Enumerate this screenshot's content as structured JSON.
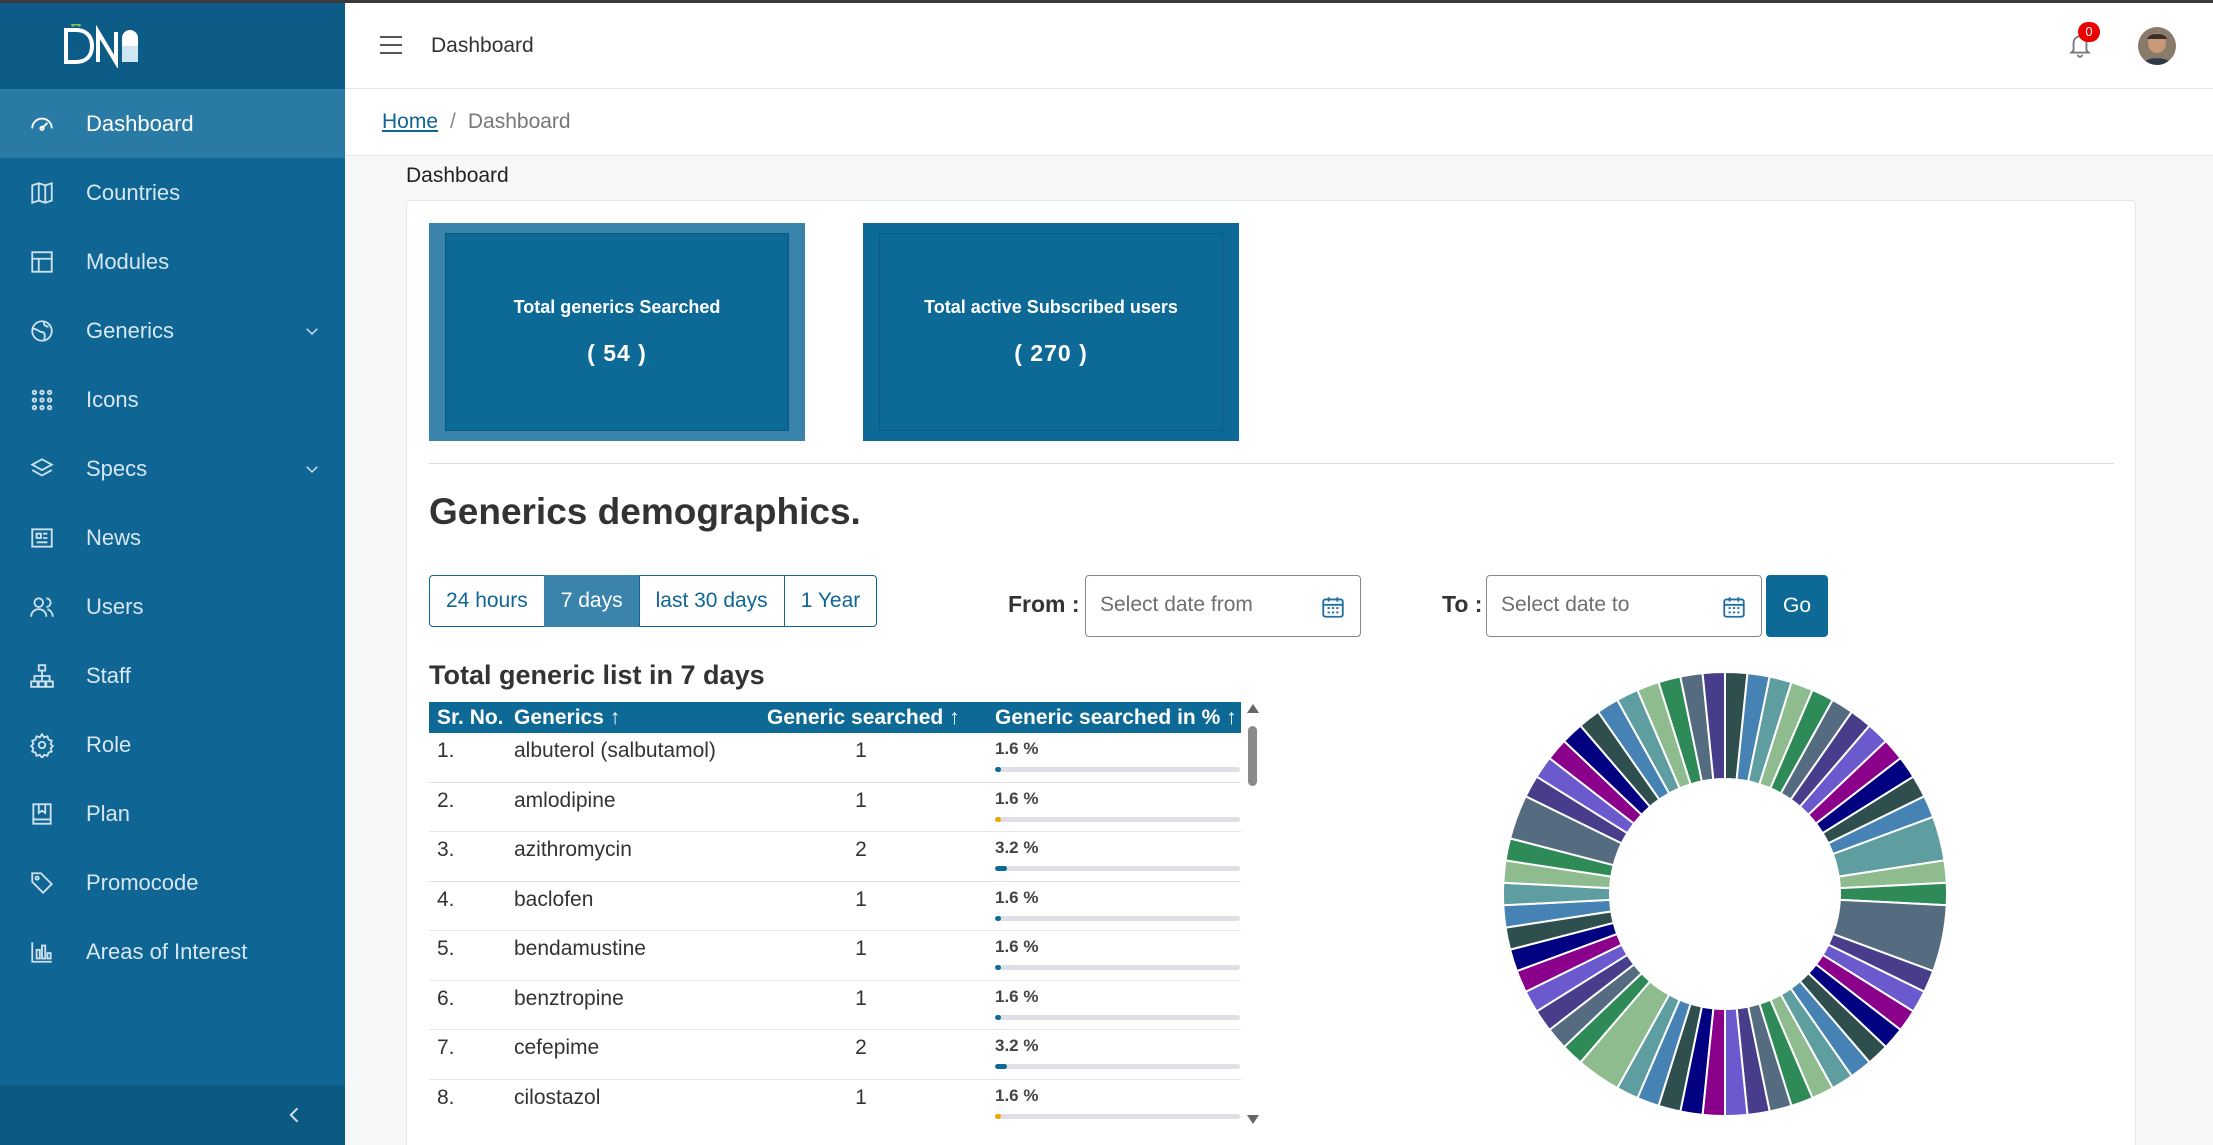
{
  "brand": {
    "logo_text": "DNB"
  },
  "sidebar": {
    "items": [
      {
        "label": "Dashboard",
        "icon": "gauge-icon",
        "active": true
      },
      {
        "label": "Countries",
        "icon": "map-icon"
      },
      {
        "label": "Modules",
        "icon": "layout-icon"
      },
      {
        "label": "Generics",
        "icon": "globe-icon",
        "expandable": true
      },
      {
        "label": "Icons",
        "icon": "grid-dots-icon"
      },
      {
        "label": "Specs",
        "icon": "layers-icon",
        "expandable": true
      },
      {
        "label": "News",
        "icon": "newspaper-icon"
      },
      {
        "label": "Users",
        "icon": "users-icon"
      },
      {
        "label": "Staff",
        "icon": "sitemap-icon"
      },
      {
        "label": "Role",
        "icon": "gear-icon"
      },
      {
        "label": "Plan",
        "icon": "bookmark-book-icon"
      },
      {
        "label": "Promocode",
        "icon": "tag-icon"
      },
      {
        "label": "Areas of Interest",
        "icon": "bar-chart-icon"
      }
    ]
  },
  "header": {
    "title": "Dashboard",
    "notifications": "0"
  },
  "breadcrumb": {
    "home": "Home",
    "separator": "/",
    "current": "Dashboard"
  },
  "page": {
    "section_label": "Dashboard",
    "stats": [
      {
        "label": "Total generics Searched",
        "value": "( 54 )"
      },
      {
        "label": "Total active Subscribed users",
        "value": "( 270 )"
      }
    ],
    "demographics_title": "Generics demographics.",
    "ranges": [
      "24 hours",
      "7 days",
      "last 30 days",
      "1 Year"
    ],
    "active_range": "7 days",
    "from_label": "From :",
    "from_placeholder": "Select date from",
    "to_label": "To :",
    "to_placeholder": "Select date to",
    "go_label": "Go",
    "list_title": "Total generic list in 7 days"
  },
  "table": {
    "headers": [
      "Sr. No.",
      "Generics ↑",
      "Generic searched ↑",
      "Generic searched in % ↑"
    ],
    "rows": [
      {
        "no": "1.",
        "name": "albuterol (salbutamol)",
        "count": "1",
        "pct": "1.6 %",
        "pct_value": 1.6,
        "bar_color": "#0d6996"
      },
      {
        "no": "2.",
        "name": "amlodipine",
        "count": "1",
        "pct": "1.6 %",
        "pct_value": 1.6,
        "bar_color": "#f0a500"
      },
      {
        "no": "3.",
        "name": "azithromycin",
        "count": "2",
        "pct": "3.2 %",
        "pct_value": 3.2,
        "bar_color": "#0d6996"
      },
      {
        "no": "4.",
        "name": "baclofen",
        "count": "1",
        "pct": "1.6 %",
        "pct_value": 1.6,
        "bar_color": "#0d6996"
      },
      {
        "no": "5.",
        "name": "bendamustine",
        "count": "1",
        "pct": "1.6 %",
        "pct_value": 1.6,
        "bar_color": "#0d6996"
      },
      {
        "no": "6.",
        "name": "benztropine",
        "count": "1",
        "pct": "1.6 %",
        "pct_value": 1.6,
        "bar_color": "#0d6996"
      },
      {
        "no": "7.",
        "name": "cefepime",
        "count": "2",
        "pct": "3.2 %",
        "pct_value": 3.2,
        "bar_color": "#0d6996"
      },
      {
        "no": "8.",
        "name": "cilostazol",
        "count": "1",
        "pct": "1.6 %",
        "pct_value": 1.6,
        "bar_color": "#f0a500"
      }
    ]
  },
  "chart_data": {
    "type": "pie",
    "donut": true,
    "palette": [
      "#2f4f4f",
      "#4682b4",
      "#5f9ea0",
      "#8fbc8f",
      "#2e8b57",
      "#556b7f",
      "#483d8b",
      "#6a5acd",
      "#8b008b",
      "#000080"
    ],
    "values": [
      1,
      1,
      1,
      1,
      1,
      1,
      1,
      1,
      1,
      1,
      1,
      1,
      2,
      1,
      1,
      3,
      1,
      1,
      1,
      1,
      1,
      1,
      1,
      1,
      1,
      1,
      1,
      1,
      1,
      1,
      1,
      1,
      1,
      2,
      1,
      1,
      1,
      1,
      1,
      1,
      1,
      1,
      1,
      1,
      1,
      2,
      1,
      1,
      1,
      1,
      1,
      1,
      1,
      1,
      1,
      1,
      1
    ]
  }
}
